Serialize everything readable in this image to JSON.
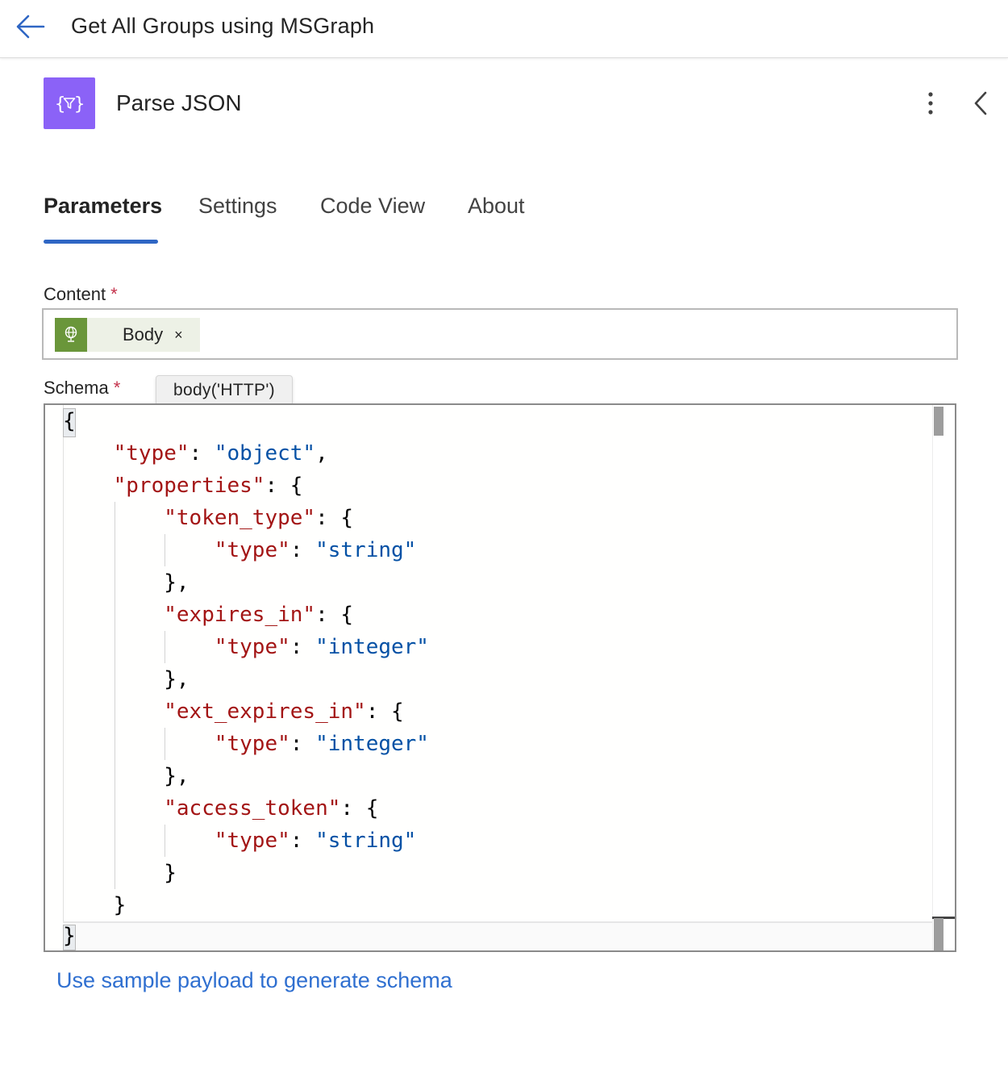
{
  "header": {
    "title": "Get All Groups using MSGraph",
    "back_icon": "arrow-left-icon"
  },
  "action": {
    "title": "Parse JSON",
    "icon": "braces-filter-icon",
    "icon_color": "#8b62f7"
  },
  "tabs": [
    {
      "label": "Parameters",
      "active": true
    },
    {
      "label": "Settings",
      "active": false
    },
    {
      "label": "Code View",
      "active": false
    },
    {
      "label": "About",
      "active": false
    }
  ],
  "content_field": {
    "label": "Content",
    "required_mark": "*",
    "token": {
      "label": "Body",
      "close": "×",
      "icon": "globe-icon",
      "color": "#6a963a"
    }
  },
  "tooltip": "body('HTTP')",
  "schema_field": {
    "label": "Schema",
    "required_mark": "*"
  },
  "schema_lines": [
    "{",
    "    \"type\": \"object\",",
    "    \"properties\": {",
    "        \"token_type\": {",
    "            \"type\": \"string\"",
    "        },",
    "        \"expires_in\": {",
    "            \"type\": \"integer\"",
    "        },",
    "        \"ext_expires_in\": {",
    "            \"type\": \"integer\"",
    "        },",
    "        \"access_token\": {",
    "            \"type\": \"string\"",
    "        }",
    "    }",
    "}"
  ],
  "sample_link": "Use sample payload to generate schema",
  "colors": {
    "accent": "#2f66c4",
    "link": "#2f6fd0",
    "json_key": "#a31515",
    "json_string": "#0451a5"
  }
}
